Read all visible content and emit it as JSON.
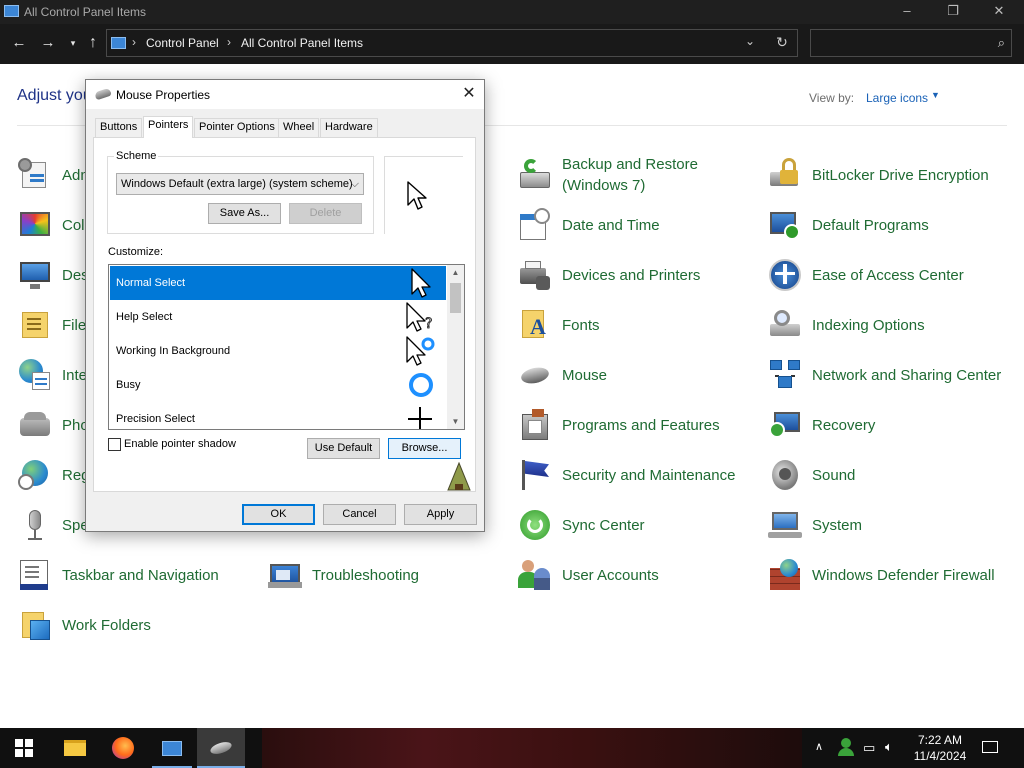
{
  "window": {
    "title": "All Control Panel Items",
    "controls": {
      "minimize": "–",
      "restore": "❐",
      "close": "✕"
    }
  },
  "nav": {
    "breadcrumbs": [
      "Control Panel",
      "All Control Panel Items"
    ],
    "search_placeholder": ""
  },
  "content": {
    "heading": "Adjust you",
    "view_by_label": "View by:",
    "view_by_value": "Large icons",
    "items_col1": [
      {
        "label": "Adm",
        "icon": "admin-tools-icon"
      },
      {
        "label": "Col",
        "icon": "color-management-icon"
      },
      {
        "label": "Des",
        "icon": "desktop-icon"
      },
      {
        "label": "File",
        "icon": "file-explorer-options-icon"
      },
      {
        "label": "Inte",
        "icon": "internet-options-icon"
      },
      {
        "label": "Pho",
        "icon": "phone-and-modem-icon"
      },
      {
        "label": "Reg",
        "icon": "region-icon"
      },
      {
        "label": "Spe",
        "icon": "speech-recognition-icon"
      },
      {
        "label": "Taskbar and Navigation",
        "icon": "taskbar-icon"
      },
      {
        "label": "Work Folders",
        "icon": "work-folders-icon"
      }
    ],
    "items_col2": [
      {
        "label": "Troubleshooting",
        "icon": "troubleshooting-icon"
      }
    ],
    "items_col3": [
      {
        "label": "Backup and Restore (Windows 7)",
        "icon": "backup-restore-icon"
      },
      {
        "label": "Date and Time",
        "icon": "date-time-icon"
      },
      {
        "label": "Devices and Printers",
        "icon": "devices-printers-icon"
      },
      {
        "label": "Fonts",
        "icon": "fonts-icon"
      },
      {
        "label": "Mouse",
        "icon": "mouse-icon"
      },
      {
        "label": "Programs and Features",
        "icon": "programs-features-icon"
      },
      {
        "label": "Security and Maintenance",
        "icon": "security-flag-icon"
      },
      {
        "label": "Sync Center",
        "icon": "sync-center-icon"
      },
      {
        "label": "User Accounts",
        "icon": "user-accounts-icon"
      }
    ],
    "items_col4": [
      {
        "label": "BitLocker Drive Encryption",
        "icon": "bitlocker-icon"
      },
      {
        "label": "Default Programs",
        "icon": "default-programs-icon"
      },
      {
        "label": "Ease of Access Center",
        "icon": "ease-of-access-icon"
      },
      {
        "label": "Indexing Options",
        "icon": "indexing-options-icon"
      },
      {
        "label": "Network and Sharing Center",
        "icon": "network-sharing-icon"
      },
      {
        "label": "Recovery",
        "icon": "recovery-icon"
      },
      {
        "label": "Sound",
        "icon": "sound-icon"
      },
      {
        "label": "System",
        "icon": "system-icon"
      },
      {
        "label": "Windows Defender Firewall",
        "icon": "firewall-icon"
      }
    ]
  },
  "dialog": {
    "title": "Mouse Properties",
    "close": "✕",
    "tabs": [
      "Buttons",
      "Pointers",
      "Pointer Options",
      "Wheel",
      "Hardware"
    ],
    "active_tab": "Pointers",
    "scheme_label": "Scheme",
    "scheme_value": "Windows Default (extra large) (system scheme)",
    "save_as": "Save As...",
    "delete": "Delete",
    "customize_label": "Customize:",
    "pointer_rows": [
      {
        "label": "Normal Select",
        "selected": true,
        "cursor": "arrow-cursor-icon"
      },
      {
        "label": "Help Select",
        "selected": false,
        "cursor": "help-cursor-icon"
      },
      {
        "label": "Working In Background",
        "selected": false,
        "cursor": "working-cursor-icon"
      },
      {
        "label": "Busy",
        "selected": false,
        "cursor": "busy-cursor-icon"
      },
      {
        "label": "Precision Select",
        "selected": false,
        "cursor": "crosshair-cursor-icon"
      }
    ],
    "shadow_label": "Enable pointer shadow",
    "shadow_checked": false,
    "use_default": "Use Default",
    "browse": "Browse...",
    "ok": "OK",
    "cancel": "Cancel",
    "apply": "Apply"
  },
  "taskbar": {
    "time": "7:22 AM",
    "date": "11/4/2024"
  },
  "colors": {
    "link_green": "#1f6b33",
    "heading_blue": "#1e3287",
    "selection_blue": "#0078d7"
  }
}
